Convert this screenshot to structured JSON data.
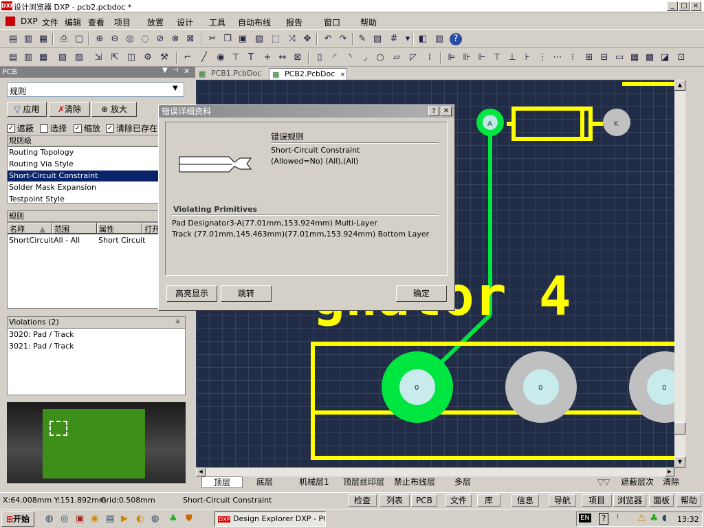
{
  "window": {
    "title": "设计浏览器 DXP - pcb2.pcbdoc *",
    "logo": "DXP"
  },
  "menu": [
    "DXP",
    "文件",
    "编辑",
    "查看",
    "项目",
    "放置",
    "设计",
    "工具",
    "自动布线",
    "报告",
    "窗口",
    "帮助"
  ],
  "panel": {
    "title": "PCB",
    "mode_select": "规则",
    "buttons": {
      "apply": "应用",
      "clear": "清除",
      "zoom": "放大"
    },
    "checks": [
      {
        "label": "遮蔽",
        "checked": true
      },
      {
        "label": "选择",
        "checked": false
      },
      {
        "label": "缩放",
        "checked": true
      },
      {
        "label": "清除已存在",
        "checked": true
      }
    ],
    "rule_classes": {
      "header": "规则级",
      "items": [
        "Routing Topology",
        "Routing Via Style",
        "Short-Circuit Constraint",
        "Solder Mask Expansion",
        "Testpoint Style"
      ],
      "selected": 2
    },
    "rules": {
      "header": "规则",
      "columns": [
        "名称",
        "范围",
        "属性",
        "打开"
      ],
      "rows": [
        {
          "name": "ShortCircuit",
          "scope": "All - All",
          "attr": "Short Circuit"
        }
      ]
    },
    "violations": {
      "header": "Violations (2)",
      "items": [
        "3020: Pad / Track",
        "3021: Pad / Track"
      ]
    }
  },
  "doc_tabs": [
    "PCB1.PcbDoc",
    "PCB2.PcbDoc"
  ],
  "dialog": {
    "title": "错误详细资料",
    "rule_header": "错误规则",
    "rule_name": "Short-Circuit Constraint",
    "rule_scope": "(Allowed=No) (All),(All)",
    "violating_header": "Violating Primitives",
    "primitives": [
      "Pad Designator3-A(77.01mm,153.924mm)  Multi-Layer",
      "Track (77.01mm,145.463mm)(77.01mm,153.924mm)  Bottom Layer"
    ],
    "buttons": {
      "highlight": "高亮显示",
      "jump": "跳转",
      "ok": "确定"
    }
  },
  "canvas": {
    "designator_text": "gnator 4",
    "pad_a": "A",
    "pad_k": "K",
    "pad_zero": "0"
  },
  "layer_tabs": [
    "顶层",
    "底层",
    "机械层1",
    "顶层丝印层",
    "禁止布线层",
    "多层"
  ],
  "layer_tools": {
    "mask": "遮蔽层次",
    "clear": "清除"
  },
  "status": {
    "coords": "X:64.008mm Y:151.892mm",
    "grid": "Grid:0.508mm",
    "rule": "Short-Circuit Constraint",
    "buttons": [
      "检查",
      "列表",
      "PCB",
      "文件",
      "库",
      "信息",
      "导航",
      "项目",
      "浏览器",
      "面板",
      "帮助"
    ]
  },
  "taskbar": {
    "start": "开始",
    "task": "Design Explorer DXP - PC...",
    "lang": "EN",
    "clock": "13:32"
  },
  "colors": {
    "board": "#212c46",
    "silk": "#ffff00",
    "pad_green": "#00ff00",
    "pad_gray": "#c0c0c0",
    "selection": "#0a246a"
  }
}
